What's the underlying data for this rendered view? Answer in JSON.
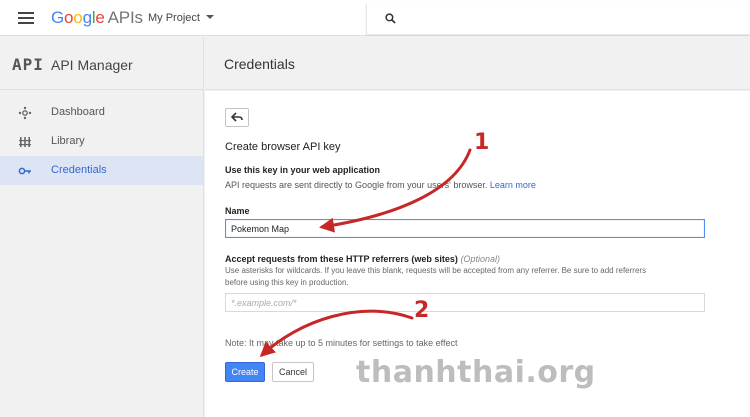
{
  "header": {
    "logo_google": [
      "G",
      "o",
      "o",
      "g",
      "l",
      "e"
    ],
    "logo_apis": "APIs",
    "project": "My Project"
  },
  "sidebar": {
    "logo": "API",
    "title": "API Manager",
    "items": [
      {
        "label": "Dashboard",
        "icon": "dashboard-icon",
        "active": false
      },
      {
        "label": "Library",
        "icon": "library-icon",
        "active": false
      },
      {
        "label": "Credentials",
        "icon": "key-icon",
        "active": true
      }
    ]
  },
  "main": {
    "title": "Credentials",
    "form_title": "Create browser API key",
    "use_heading": "Use this key in your web application",
    "use_text": "API requests are sent directly to Google from your users' browser.",
    "learn_more": "Learn more",
    "name_label": "Name",
    "name_value": "Pokemon Map",
    "referrer_label": "Accept requests from these HTTP referrers (web sites)",
    "referrer_optional": "(Optional)",
    "referrer_help_1": "Use asterisks for wildcards. If you leave this blank, requests will be accepted from any referrer. Be sure to add referrers",
    "referrer_help_2": "before using this key in production.",
    "referrer_placeholder": "*.example.com/*",
    "note": "Note: It may take up to 5 minutes for settings to take effect",
    "create_label": "Create",
    "cancel_label": "Cancel"
  },
  "annotations": {
    "marker_1": "1",
    "marker_2": "2",
    "watermark": "thanhthai.org",
    "color": "#c62828"
  },
  "colors": {
    "accent": "#4285f4",
    "active_bg": "#dde5f4",
    "active_text": "#3367d6"
  }
}
